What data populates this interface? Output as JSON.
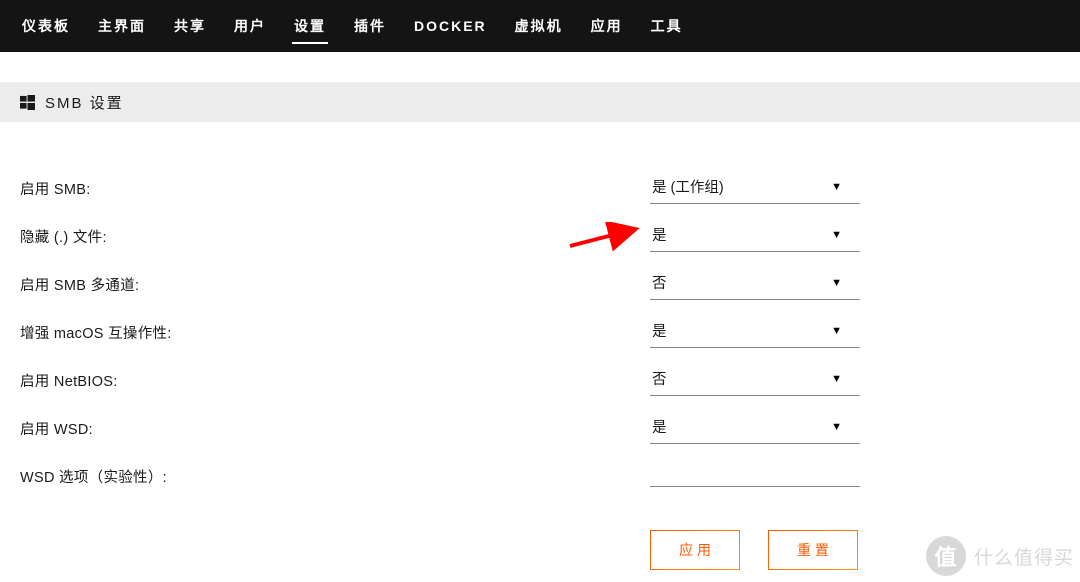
{
  "nav": {
    "items": [
      {
        "label": "仪表板"
      },
      {
        "label": "主界面"
      },
      {
        "label": "共享"
      },
      {
        "label": "用户"
      },
      {
        "label": "设置",
        "active": true
      },
      {
        "label": "插件"
      },
      {
        "label": "DOCKER"
      },
      {
        "label": "虚拟机"
      },
      {
        "label": "应用"
      },
      {
        "label": "工具"
      }
    ]
  },
  "section": {
    "title": "SMB 设置"
  },
  "form": {
    "rows": [
      {
        "label": "启用 SMB:",
        "value": "是 (工作组)"
      },
      {
        "label": "隐藏 (.) 文件:",
        "value": "是"
      },
      {
        "label": "启用 SMB 多通道:",
        "value": "否"
      },
      {
        "label": "增强 macOS 互操作性:",
        "value": "是"
      },
      {
        "label": "启用 NetBIOS:",
        "value": "否"
      },
      {
        "label": "启用 WSD:",
        "value": "是"
      },
      {
        "label": "WSD 选项（实验性）:",
        "value": ""
      }
    ]
  },
  "buttons": {
    "apply": "应用",
    "reset": "重置"
  },
  "watermark": {
    "badge": "值",
    "text": "什么值得买"
  }
}
